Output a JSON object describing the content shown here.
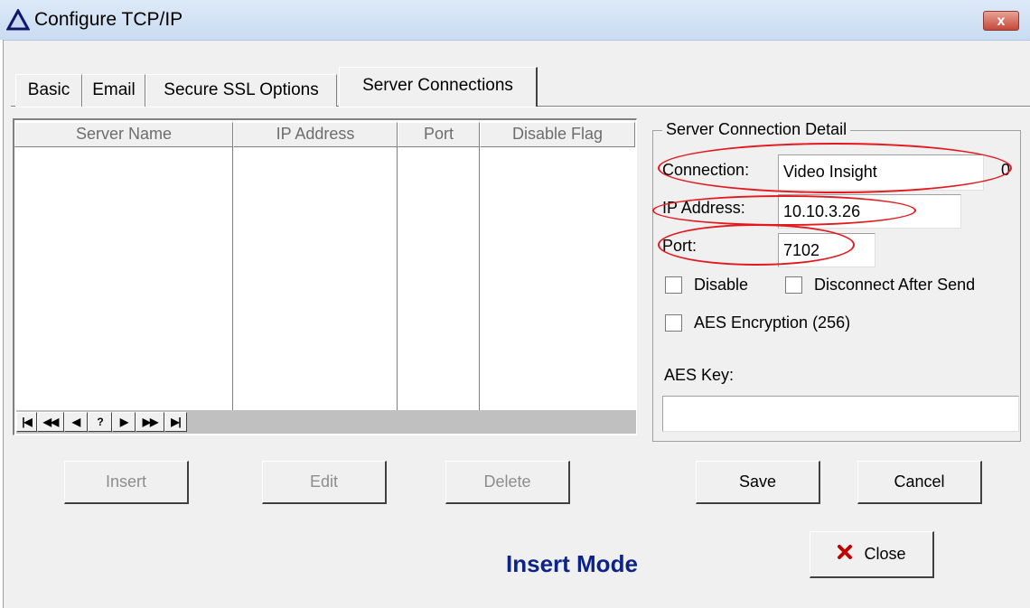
{
  "window": {
    "title": "Configure TCP/IP",
    "close_glyph": "x",
    "icon": "triangle-icon"
  },
  "tabs": [
    {
      "label": "Basic"
    },
    {
      "label": "Email"
    },
    {
      "label": "Secure SSL Options"
    },
    {
      "label": "Server Connections",
      "selected": true
    }
  ],
  "grid": {
    "columns": [
      "Server Name",
      "IP Address",
      "Port",
      "Disable Flag"
    ],
    "rows": [],
    "nav_buttons": [
      "|◀",
      "◀◀",
      "◀",
      "?",
      "▶",
      "▶▶",
      "▶|"
    ]
  },
  "detail": {
    "title": "Server Connection Detail",
    "connection_label": "Connection:",
    "connection_value": "Video Insight",
    "connection_suffix": "0",
    "ip_label": "IP Address:",
    "ip_value": "10.10.3.26",
    "port_label": "Port:",
    "port_value": "7102",
    "disable_label": "Disable",
    "disconnect_label": "Disconnect After Send",
    "aes_label": "AES Encryption (256)",
    "aes_key_label": "AES Key:",
    "aes_key_value": ""
  },
  "buttons": {
    "insert": "Insert",
    "edit": "Edit",
    "delete": "Delete",
    "save": "Save",
    "cancel": "Cancel",
    "close": "Close"
  },
  "status": {
    "mode": "Insert Mode"
  },
  "colors": {
    "annotation_red": "#e3191e",
    "mode_text": "#0b238a",
    "close_icon": "#c00000"
  }
}
